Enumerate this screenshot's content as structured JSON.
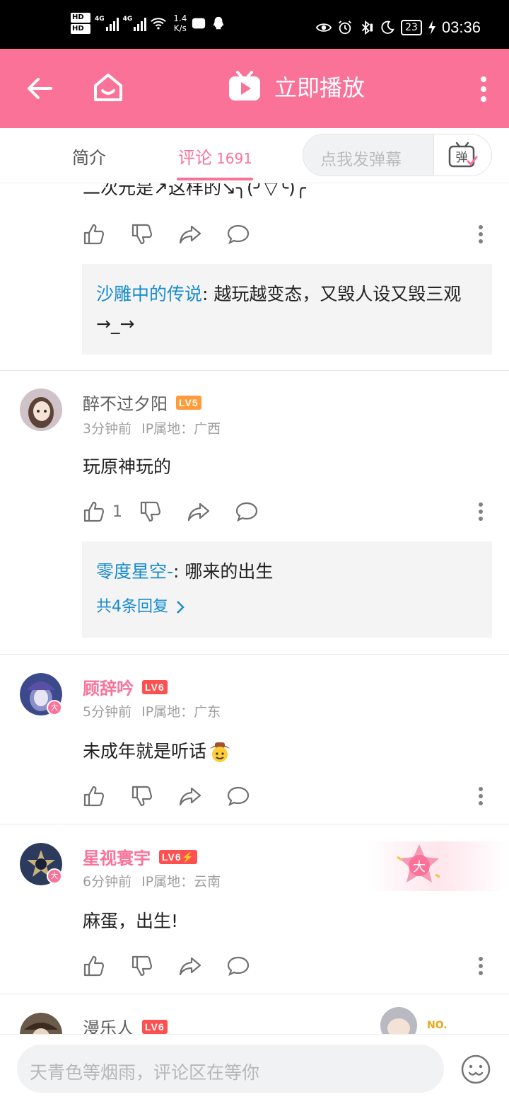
{
  "status_bar": {
    "hd1": "HD",
    "hd2": "HD",
    "net1": "4G",
    "net2": "4G",
    "speed_value": "1.4",
    "speed_unit": "K/s",
    "battery": "23",
    "time": "03:36"
  },
  "header": {
    "title": "立即播放"
  },
  "tabs": {
    "intro": "简介",
    "comments": "评论",
    "comments_count": "1691",
    "danmaku_placeholder": "点我发弹幕",
    "danmaku_button_glyph": "弹"
  },
  "comments": [
    {
      "text": "二次元是↗这样的↘╮(╯▽╰)╭",
      "likes": "",
      "reply": {
        "name": "沙雕中的传说",
        "text": ": 越玩越变态，又毁人设又毁三观→_→"
      }
    },
    {
      "user": "醉不过夕阳",
      "level": "LV5",
      "time": "3分钟前",
      "ip": "IP属地：广西",
      "text": "玩原神玩的",
      "likes": "1",
      "reply": {
        "name": "零度星空-",
        "text": ": 哪来的出生",
        "more": "共4条回复"
      }
    },
    {
      "user": "顾辞吟",
      "level": "LV6",
      "time": "5分钟前",
      "ip": "IP属地：广东",
      "text": "未成年就是听话",
      "vip_badge": "大"
    },
    {
      "user": "星视寰宇",
      "level": "LV6⚡",
      "time": "6分钟前",
      "ip": "IP属地：云南",
      "text": "麻蛋，出生!",
      "vip_badge": "大",
      "deco_badge": "大"
    },
    {
      "user": "漫乐人",
      "level": "LV6",
      "deco_text": "NO."
    }
  ],
  "bottom": {
    "placeholder": "天青色等烟雨，评论区在等你"
  },
  "colors": {
    "brand_pink": "#fb7299",
    "link_blue": "#178bcf",
    "lv5": "#ff9b3b",
    "lv6": "#fe5050"
  }
}
